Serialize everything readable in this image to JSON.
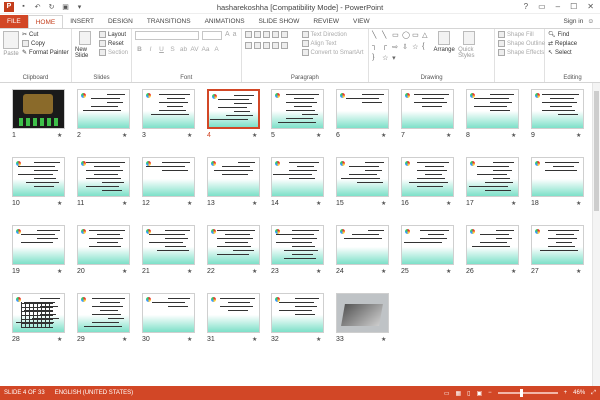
{
  "window": {
    "title": "hasharekoshha [Compatibility Mode] - PowerPoint",
    "controls": [
      "?",
      "▭",
      "–",
      "☐",
      "✕"
    ]
  },
  "ribbon_tabs": [
    "FILE",
    "HOME",
    "INSERT",
    "DESIGN",
    "TRANSITIONS",
    "ANIMATIONS",
    "SLIDE SHOW",
    "REVIEW",
    "VIEW"
  ],
  "active_tab": "HOME",
  "sign_in": "Sign in",
  "clipboard": {
    "paste": "Paste",
    "cut": "Cut",
    "copy": "Copy",
    "format_painter": "Format Painter",
    "label": "Clipboard"
  },
  "slides_group": {
    "new_slide": "New Slide",
    "layout": "Layout",
    "reset": "Reset",
    "section": "Section",
    "label": "Slides"
  },
  "font_group": {
    "label": "Font"
  },
  "paragraph_group": {
    "text_direction": "Text Direction",
    "align_text": "Align Text",
    "convert_smartart": "Convert to SmartArt",
    "label": "Paragraph"
  },
  "drawing_group": {
    "arrange": "Arrange",
    "quick_styles": "Quick Styles",
    "shape_fill": "Shape Fill",
    "shape_outline": "Shape Outline",
    "shape_effects": "Shape Effects",
    "label": "Drawing"
  },
  "editing_group": {
    "find": "Find",
    "replace": "Replace",
    "select": "Select",
    "label": "Editing"
  },
  "slides": [
    {
      "n": "1"
    },
    {
      "n": "2"
    },
    {
      "n": "3"
    },
    {
      "n": "4"
    },
    {
      "n": "5"
    },
    {
      "n": "6"
    },
    {
      "n": "7"
    },
    {
      "n": "8"
    },
    {
      "n": "9"
    },
    {
      "n": "10"
    },
    {
      "n": "11"
    },
    {
      "n": "12"
    },
    {
      "n": "13"
    },
    {
      "n": "14"
    },
    {
      "n": "15"
    },
    {
      "n": "16"
    },
    {
      "n": "17"
    },
    {
      "n": "18"
    },
    {
      "n": "19"
    },
    {
      "n": "20"
    },
    {
      "n": "21"
    },
    {
      "n": "22"
    },
    {
      "n": "23"
    },
    {
      "n": "24"
    },
    {
      "n": "25"
    },
    {
      "n": "26"
    },
    {
      "n": "27"
    },
    {
      "n": "28"
    },
    {
      "n": "29"
    },
    {
      "n": "30"
    },
    {
      "n": "31"
    },
    {
      "n": "32"
    },
    {
      "n": "33"
    }
  ],
  "selected_slide": 4,
  "status": {
    "slide_indicator": "SLIDE 4 OF 33",
    "language": "ENGLISH (UNITED STATES)",
    "zoom": "46%"
  },
  "colors": {
    "accent": "#d24726",
    "slide_gradient": "#7de0c8"
  }
}
